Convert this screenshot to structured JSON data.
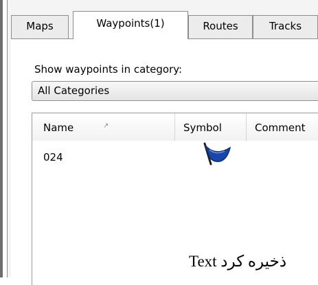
{
  "tabs": [
    {
      "label": "Maps"
    },
    {
      "label": "Waypoints(1)",
      "active": true
    },
    {
      "label": "Routes"
    },
    {
      "label": "Tracks"
    }
  ],
  "category": {
    "label": "Show waypoints in category:",
    "selected": "All Categories"
  },
  "table": {
    "columns": [
      "Name",
      "Symbol",
      "Comment"
    ],
    "sort_indicator": "↗",
    "rows": [
      {
        "name": "024",
        "symbol": "flag-icon"
      }
    ]
  },
  "overlay_text": "Text ذخیره کرد",
  "colors": {
    "flag": "#1747a8",
    "border": "#8d8d8d"
  }
}
